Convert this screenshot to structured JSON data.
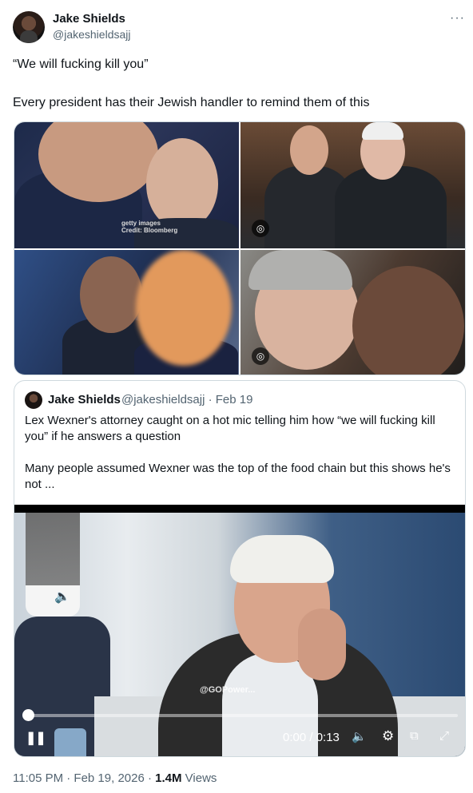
{
  "author": {
    "name": "Jake Shields",
    "handle": "@jakeshieldsajj"
  },
  "more_label": "···",
  "tweet": {
    "line1": "“We will fucking kill you”",
    "line2": "Every president has their Jewish handler to remind them of this"
  },
  "media": {
    "watermark_line1": "getty images",
    "watermark_line2": "Credit: Bloomberg",
    "lens_icon_glyph": "◎"
  },
  "quote": {
    "name": "Jake Shields",
    "handle_date": "@jakeshieldsajj · Feb 19",
    "text1": "Lex Wexner's attorney caught on a hot mic telling him how “we will fucking kill you” if he answers a question",
    "text2": "Many people assumed Wexner was the top of the food chain but this shows he's not ..."
  },
  "video": {
    "watermark": "@GOPower...",
    "time": "0:00 / 0:13",
    "progress": 0.0,
    "pause_glyph": "❚❚",
    "volume_glyph": "🔈",
    "gear_glyph": "⚙",
    "pip_glyph": "⧉",
    "expand_glyph": "⤢"
  },
  "footer": {
    "timestamp": "11:05 PM · Feb 19, 2026 · ",
    "views_count": "1.4M",
    "views_label": " Views"
  },
  "colors": {
    "text": "#0f1419",
    "secondary": "#536471",
    "border": "#cfd9de"
  }
}
